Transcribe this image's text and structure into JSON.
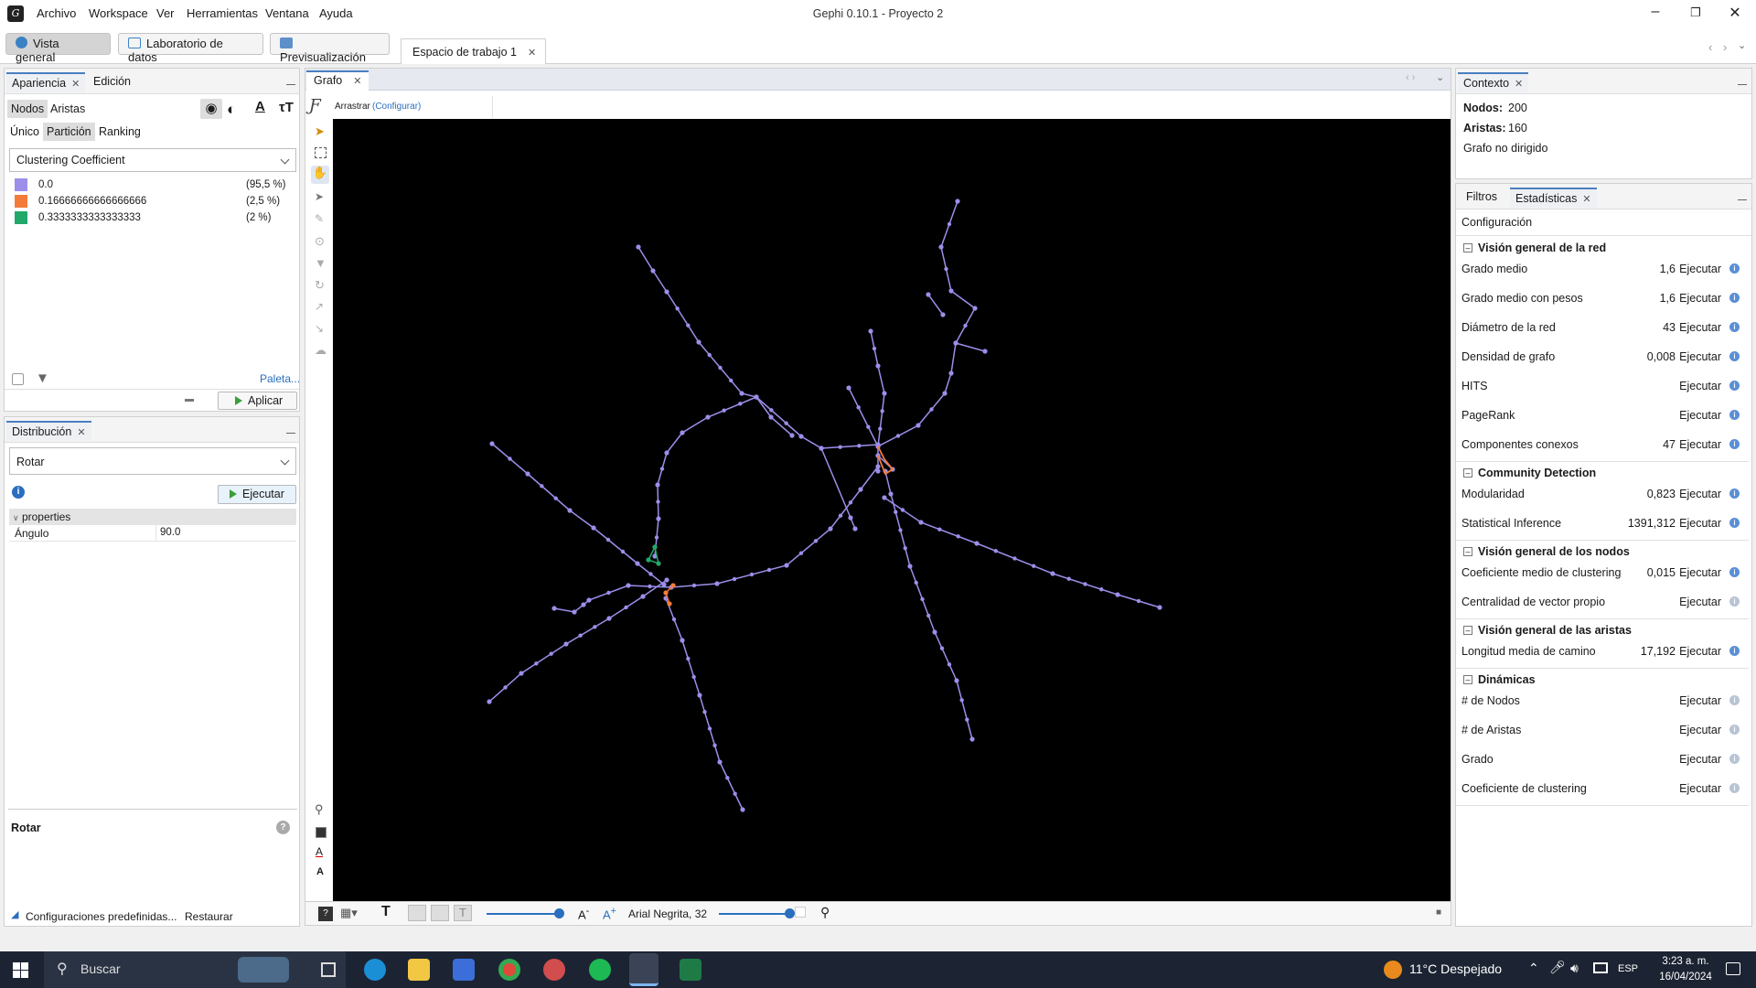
{
  "app": {
    "title": "Gephi 0.10.1 - Proyecto 2",
    "menu": [
      "Archivo",
      "Workspace",
      "Ver",
      "Herramientas",
      "Ventana",
      "Ayuda"
    ]
  },
  "modes": {
    "overview": "Vista general",
    "datalab": "Laboratorio de datos",
    "preview": "Previsualización",
    "workspace_tab": "Espacio de trabajo 1"
  },
  "appearance": {
    "tab_label": "Apariencia",
    "edit_tab": "Edición",
    "nodes_tab": "Nodos",
    "edges_tab": "Aristas",
    "unique_tab": "Único",
    "partition_tab": "Partición",
    "ranking_tab": "Ranking",
    "attribute": "Clustering Coefficient",
    "partitions": [
      {
        "label": "0.0",
        "percent": "(95,5 %)",
        "color": "#9b8fea"
      },
      {
        "label": "0.16666666666666666",
        "percent": "(2,5 %)",
        "color": "#f47b3a"
      },
      {
        "label": "0.3333333333333333",
        "percent": "(2 %)",
        "color": "#22a86a"
      }
    ],
    "palette_link": "Paleta...",
    "apply_button": "Aplicar"
  },
  "layout": {
    "tab_label": "Distribución",
    "algorithm": "Rotar",
    "run_button": "Ejecutar",
    "properties_header": "properties",
    "prop_name": "Ángulo",
    "prop_value": "90.0",
    "description_title": "Rotar",
    "presets": "Configuraciones predefinidas...",
    "reset": "Restaurar"
  },
  "graph": {
    "tab_label": "Grafo",
    "mode_label": "Arrastrar",
    "config_link": "(Configurar)",
    "font_label": "Arial Negrita, 32",
    "colors": {
      "node": "#9b8fea",
      "orange": "#f47b3a",
      "green": "#22a86a",
      "background": "#000000"
    }
  },
  "context": {
    "tab_label": "Contexto",
    "nodes_label": "Nodos:",
    "nodes_value": "200",
    "edges_label": "Aristas:",
    "edges_value": "160",
    "graph_type": "Grafo no dirigido"
  },
  "statistics": {
    "filters_tab": "Filtros",
    "stats_tab": "Estadísticas",
    "settings": "Configuración",
    "run_label": "Ejecutar",
    "sections": [
      {
        "title": "Visión general de la red",
        "rows": [
          {
            "name": "Grado medio",
            "value": "1,6"
          },
          {
            "name": "Grado medio con pesos",
            "value": "1,6"
          },
          {
            "name": "Diámetro de la red",
            "value": "43"
          },
          {
            "name": "Densidad de grafo",
            "value": "0,008"
          },
          {
            "name": "HITS",
            "value": ""
          },
          {
            "name": "PageRank",
            "value": ""
          },
          {
            "name": "Componentes conexos",
            "value": "47"
          }
        ]
      },
      {
        "title": "Community Detection",
        "rows": [
          {
            "name": "Modularidad",
            "value": "0,823"
          },
          {
            "name": "Statistical Inference",
            "value": "1391,312"
          }
        ]
      },
      {
        "title": "Visión general de los nodos",
        "rows": [
          {
            "name": "Coeficiente medio de clustering",
            "value": "0,015"
          },
          {
            "name": "Centralidad de vector propio",
            "value": ""
          }
        ]
      },
      {
        "title": "Visión general de las aristas",
        "rows": [
          {
            "name": "Longitud media de camino",
            "value": "17,192"
          }
        ]
      },
      {
        "title": "Dinámicas",
        "rows": [
          {
            "name": "# de Nodos",
            "value": ""
          },
          {
            "name": "# de Aristas",
            "value": ""
          },
          {
            "name": "Grado",
            "value": ""
          },
          {
            "name": "Coeficiente de clustering",
            "value": ""
          }
        ]
      }
    ]
  },
  "taskbar": {
    "search_placeholder": "Buscar",
    "weather": "11°C  Despejado",
    "lang": "ESP",
    "time": "3:23 a. m.",
    "date": "16/04/2024"
  }
}
